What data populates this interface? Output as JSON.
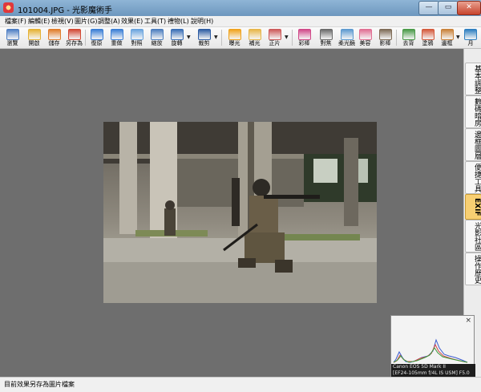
{
  "window": {
    "title": "101004.JPG - 光影魔術手"
  },
  "menu": [
    "檔案(F)",
    "編輯(E)",
    "檢視(V)",
    "圖片(G)",
    "調整(A)",
    "效果(E)",
    "工具(T)",
    "禮物(L)",
    "說明(H)"
  ],
  "toolbar": {
    "buttons": [
      {
        "label": "瀏覽",
        "color": "#4f7fc4"
      },
      {
        "label": "開啟",
        "color": "#e5b235"
      },
      {
        "label": "儲存",
        "color": "#e07d2b"
      },
      {
        "label": "另存為",
        "color": "#d24a35"
      },
      {
        "label": "復原",
        "color": "#3b7fd6"
      },
      {
        "label": "重做",
        "color": "#3b7fd6"
      },
      {
        "label": "對照",
        "color": "#6aa4de"
      },
      {
        "label": "縮放",
        "color": "#4e7fbf"
      },
      {
        "label": "旋轉",
        "color": "#3a6fb6"
      },
      {
        "label": "裁剪",
        "color": "#2f5da3"
      },
      {
        "label": "曝光",
        "color": "#f0a31d"
      },
      {
        "label": "補光",
        "color": "#e7b64a"
      },
      {
        "label": "正片",
        "color": "#cd5a5a"
      },
      {
        "label": "彩棒",
        "color": "#d04a89"
      },
      {
        "label": "對焦",
        "color": "#6b6b6b"
      },
      {
        "label": "柔光鏡",
        "color": "#5d9ad0"
      },
      {
        "label": "美容",
        "color": "#e06f93"
      },
      {
        "label": "影棒",
        "color": "#7f6c57"
      },
      {
        "label": "去背",
        "color": "#4a9a48"
      },
      {
        "label": "塗鴉",
        "color": "#d45a3c"
      },
      {
        "label": "邊框",
        "color": "#c9823a"
      },
      {
        "label": "月",
        "color": "#2e7fc0"
      }
    ]
  },
  "right_panel": {
    "tabs": [
      "基本調整",
      "數碼暗房",
      "邊框圖層",
      "便捷工具",
      "EXIF",
      "光影社區",
      "操作歷史"
    ],
    "active": "EXIF"
  },
  "histogram": {
    "close": "×",
    "info_line1": "Canon EOS 5D Mark II",
    "info_line2": "[EF24-105mm f/4L IS USM] F5.0"
  },
  "status": {
    "text": "目前效果另存為圖片檔案"
  }
}
